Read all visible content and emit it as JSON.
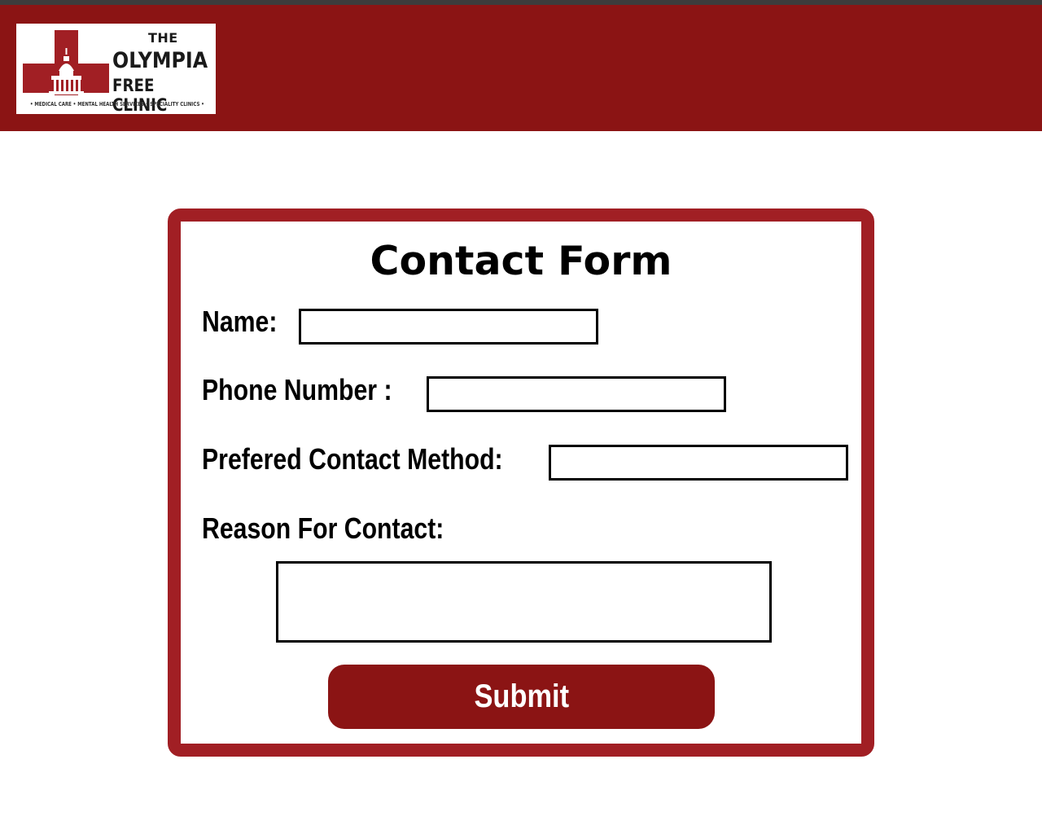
{
  "header": {
    "logo": {
      "the": "THE",
      "name_line1": "OLYMPIA",
      "name_line2": "FREE CLINIC",
      "tagline": "• MEDICAL CARE • MENTAL HEALTH SERVICES • SPECIALITY CLINICS •",
      "brand_color": "#8b1414"
    }
  },
  "form": {
    "title": "Contact Form",
    "name_label": "Name:",
    "name_value": "",
    "phone_label": "Phone Number :",
    "phone_value": "",
    "method_label": "Prefered Contact Method:",
    "method_value": "",
    "reason_label": "Reason For Contact:",
    "reason_value": "",
    "submit_label": "Submit",
    "border_color": "#a11f24",
    "button_color": "#8b1414"
  }
}
